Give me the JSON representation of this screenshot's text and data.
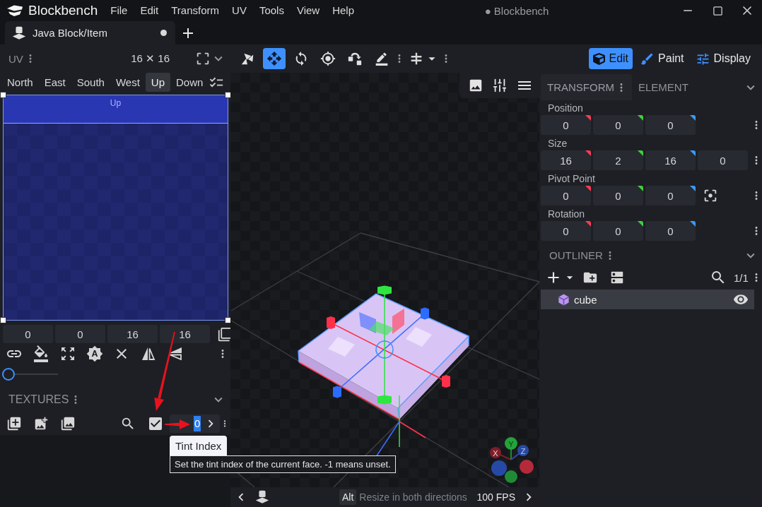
{
  "window": {
    "app_name": "Blockbench",
    "menu": [
      "File",
      "Edit",
      "Transform",
      "UV",
      "Tools",
      "View",
      "Help"
    ],
    "title": "● Blockbench"
  },
  "tabs": [
    {
      "label": "Java Block/Item",
      "selected": true,
      "unsaved": true
    }
  ],
  "uv_panel": {
    "title": "UV",
    "size": "16 ✕ 16",
    "faces": [
      {
        "label": "North",
        "selected": false
      },
      {
        "label": "East",
        "selected": false
      },
      {
        "label": "South",
        "selected": false
      },
      {
        "label": "West",
        "selected": false
      },
      {
        "label": "Up",
        "selected": true
      },
      {
        "label": "Down",
        "selected": false
      }
    ],
    "face_label": "Up",
    "fields": [
      "0",
      "0",
      "16",
      "16"
    ],
    "slider": {
      "level": 0
    }
  },
  "textures_panel": {
    "title": "TEXTURES",
    "checkbox": {
      "checked": true
    },
    "tint_index": {
      "value": "0",
      "text_selected": true
    }
  },
  "tooltip": {
    "title": "Tint Index",
    "description": "Set the tint index of the current face. -1 means unset."
  },
  "toolbar": {
    "tools": [
      {
        "kind": "transform",
        "selected": false
      },
      {
        "kind": "move",
        "selected": true
      },
      {
        "kind": "rotate",
        "selected": false
      },
      {
        "kind": "pivot",
        "selected": false
      },
      {
        "kind": "snap",
        "selected": false
      },
      {
        "kind": "brush",
        "selected": false
      }
    ],
    "modes": [
      {
        "kind": "edit",
        "label": "Edit",
        "selected": true
      },
      {
        "kind": "paint",
        "label": "Paint",
        "selected": false
      },
      {
        "kind": "display",
        "label": "Display",
        "selected": false
      }
    ]
  },
  "viewport": {
    "axis_labels": [
      "X",
      "Y",
      "Z"
    ]
  },
  "transform_panel": {
    "tabs": [
      {
        "label": "TRANSFORM",
        "selected": true
      },
      {
        "label": "ELEMENT",
        "selected": false
      }
    ],
    "groups": [
      {
        "label": "Position",
        "values": [
          "0",
          "0",
          "0"
        ],
        "center_button": false
      },
      {
        "label": "Size",
        "values": [
          "16",
          "2",
          "16",
          "0"
        ],
        "center_button": false
      },
      {
        "label": "Pivot Point",
        "values": [
          "0",
          "0",
          "0"
        ],
        "center_button": true
      },
      {
        "label": "Rotation",
        "values": [
          "0",
          "0",
          "0"
        ],
        "center_button": false
      }
    ]
  },
  "outliner": {
    "title": "OUTLINER",
    "count": "1/1",
    "items": [
      {
        "name": "cube",
        "selected": true,
        "visible": true
      }
    ]
  },
  "status_bar": {
    "key": "Alt",
    "hint": "Resize in both directions",
    "fps": "100 FPS"
  }
}
